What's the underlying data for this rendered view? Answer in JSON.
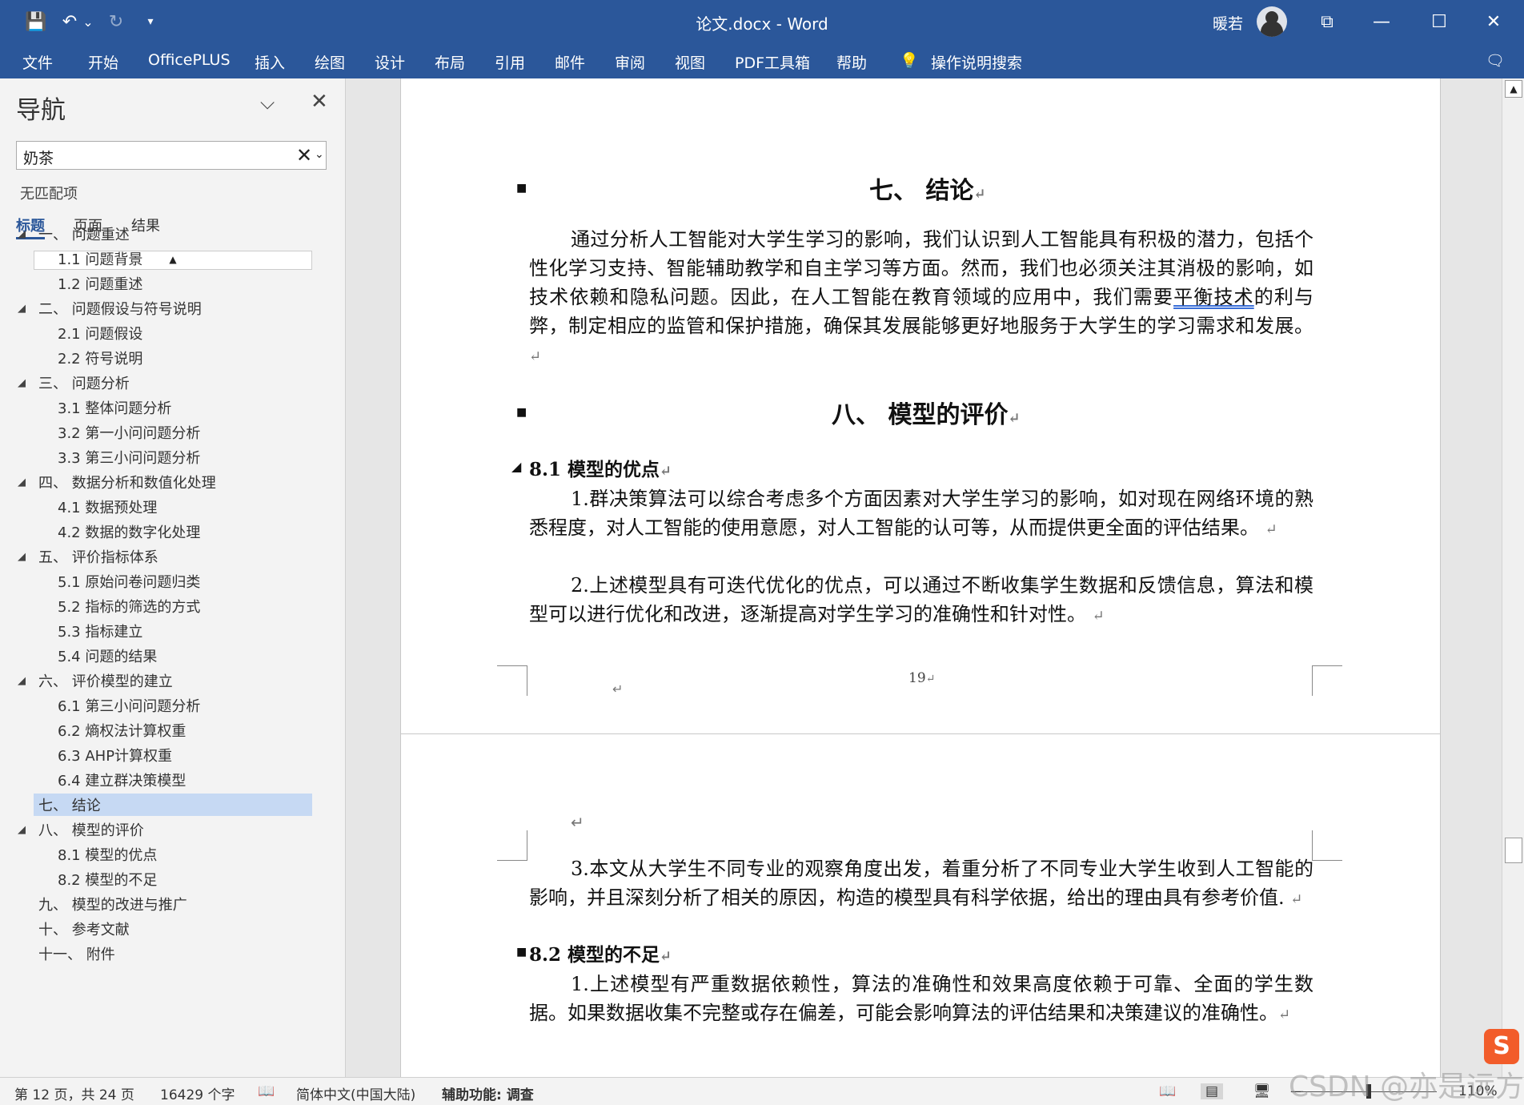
{
  "titlebar": {
    "title": "论文.docx  -  Word",
    "user": "暖若",
    "quick_access": {
      "save": "💾",
      "undo": "↶",
      "undo_drop": "⌄",
      "redo": "↻",
      "customize": "▾"
    },
    "window": {
      "ribbon_display": "⧉",
      "minimize": "—",
      "maximize": "☐",
      "close": "✕"
    }
  },
  "ribbon": {
    "tabs": [
      "文件",
      "开始",
      "OfficePLUS",
      "插入",
      "绘图",
      "设计",
      "布局",
      "引用",
      "邮件",
      "审阅",
      "视图",
      "PDF工具箱",
      "帮助"
    ],
    "tell_me": "操作说明搜索",
    "tell_me_icon": "💡",
    "comments_icon": "🗨"
  },
  "nav": {
    "title": "导航",
    "collapse_icon": "⌵",
    "close_icon": "✕",
    "search_value": "奶茶",
    "search_clear": "✕",
    "search_dropdown": "⌄",
    "status": "无匹配项",
    "tabs": [
      "标题",
      "页面",
      "结果"
    ],
    "scroll_up": "▲",
    "outline": [
      {
        "text": "一、  问题重述",
        "level": 1,
        "expanded": true
      },
      {
        "text": "1.1 问题背景",
        "level": 2
      },
      {
        "text": "1.2 问题重述",
        "level": 2
      },
      {
        "text": "二、  问题假设与符号说明",
        "level": 1,
        "expanded": true
      },
      {
        "text": "2.1 问题假设",
        "level": 2
      },
      {
        "text": "2.2 符号说明",
        "level": 2
      },
      {
        "text": "三、  问题分析",
        "level": 1,
        "expanded": true
      },
      {
        "text": "3.1 整体问题分析",
        "level": 2
      },
      {
        "text": "3.2 第一小问问题分析",
        "level": 2
      },
      {
        "text": "3.3 第三小问问题分析",
        "level": 2
      },
      {
        "text": "四、  数据分析和数值化处理",
        "level": 1,
        "expanded": true
      },
      {
        "text": "4.1 数据预处理",
        "level": 2
      },
      {
        "text": "4.2 数据的数字化处理",
        "level": 2
      },
      {
        "text": "五、  评价指标体系",
        "level": 1,
        "expanded": true
      },
      {
        "text": "5.1 原始问卷问题归类",
        "level": 2
      },
      {
        "text": "5.2 指标的筛选的方式",
        "level": 2
      },
      {
        "text": "5.3 指标建立",
        "level": 2
      },
      {
        "text": "5.4 问题的结果",
        "level": 2
      },
      {
        "text": "六、  评价模型的建立",
        "level": 1,
        "expanded": true
      },
      {
        "text": "6.1 第三小问问题分析",
        "level": 2
      },
      {
        "text": "6.2 熵权法计算权重",
        "level": 2
      },
      {
        "text": "6.3 AHP计算权重",
        "level": 2
      },
      {
        "text": "6.4 建立群决策模型",
        "level": 2
      },
      {
        "text": "七、  结论",
        "level": 1,
        "selected": true
      },
      {
        "text": "八、  模型的评价",
        "level": 1,
        "expanded": true
      },
      {
        "text": "8.1 模型的优点",
        "level": 2
      },
      {
        "text": "8.2 模型的不足",
        "level": 2
      },
      {
        "text": "九、  模型的改进与推广",
        "level": 1
      },
      {
        "text": "十、  参考文献",
        "level": 1
      },
      {
        "text": "十一、  附件",
        "level": 1
      }
    ]
  },
  "document": {
    "return_mark": "↵",
    "page1": {
      "h_conclusion": "七、 结论",
      "conclusion_a": "通过分析人工智能对大学生学习的影响，我们认识到人工智能具有积极的潜力，包括个性化学习支持、智能辅助教学和自主学习等方面。然而，我们也必须关注其消极的影响，如技术依赖和隐私问题。因此，在人工智能在教育领域的应用中，我们需要",
      "conclusion_u": "平衡技术",
      "conclusion_b": "的利与弊，制定相应的监管和保护措施，确保其发展能够更好地服务于大学生的学习需求和发展。",
      "h_eval": "八、  模型的评价",
      "h_pros": "8.1 模型的优点",
      "pros_1": "1.群决策算法可以综合考虑多个方面因素对大学生学习的影响，如对现在网络环境的熟悉程度，对人工智能的使用意愿，对人工智能的认可等，从而提供更全面的评估结果。",
      "pros_2": "2.上述模型具有可迭代优化的优点，可以通过不断收集学生数据和反馈信息，算法和模型可以进行优化和改进，逐渐提高对学生学习的准确性和针对性。",
      "page_number": "19"
    },
    "page2": {
      "pros_3": "3.本文从大学生不同专业的观察角度出发，着重分析了不同专业大学生收到人工智能的影响，并且深刻分析了相关的原因，构造的模型具有科学依据，给出的理由具有参考价值.",
      "h_cons": "8.2 模型的不足",
      "cons_1": "1.上述模型有严重数据依赖性，算法的准确性和效果高度依赖于可靠、全面的学生数据。如果数据收集不完整或存在偏差，可能会影响算法的评估结果和决策建议的准确性。"
    }
  },
  "statusbar": {
    "page": "第 12 页，共 24 页",
    "words": "16429 个字",
    "proof_icon": "📖",
    "language": "简体中文(中国大陆)",
    "accessibility": "辅助功能: 调查",
    "view_read": "📖",
    "view_print": "▤",
    "view_web": "🖥",
    "zoom_minus": "—",
    "zoom": "110%",
    "watermark": "CSDN @亦是远方",
    "ime": "S"
  }
}
